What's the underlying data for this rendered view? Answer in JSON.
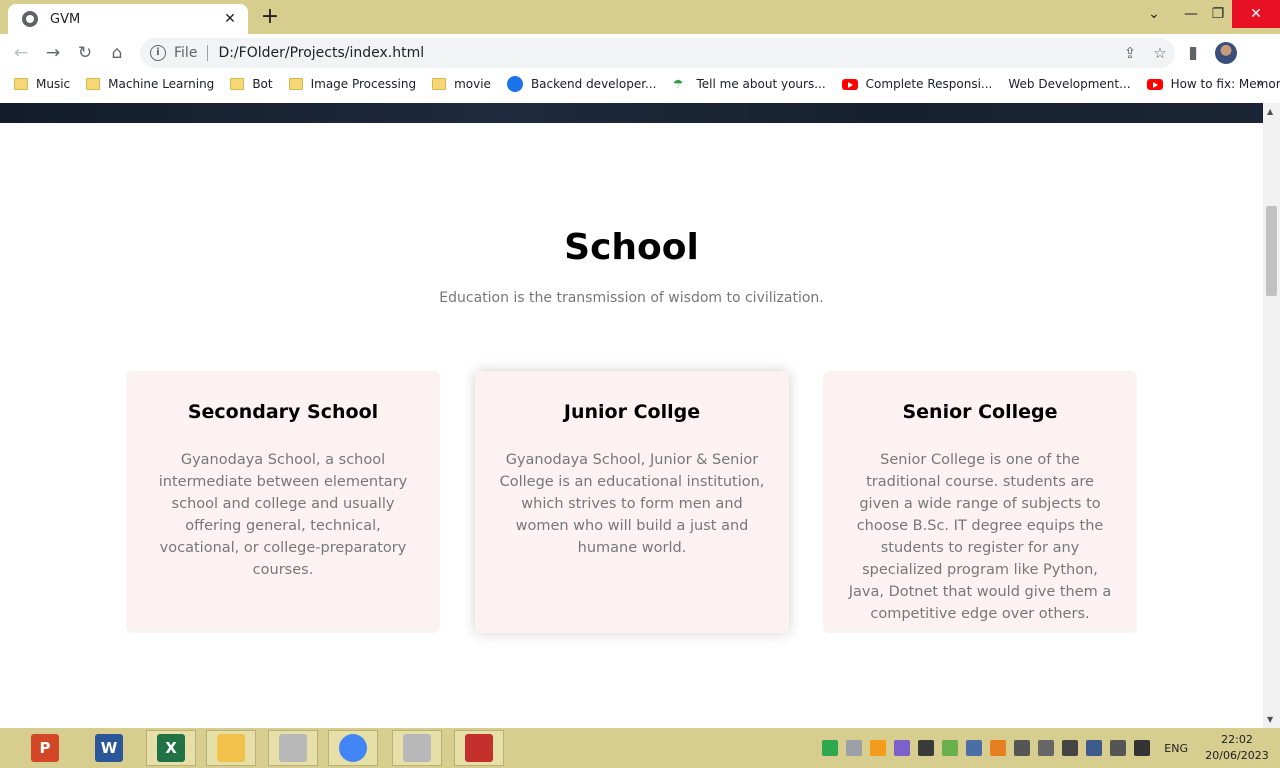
{
  "browser": {
    "tab_title": "GVM",
    "tab_close": "✕",
    "new_tab": "+",
    "omnibox": {
      "info_icon": "i",
      "scheme": "File",
      "url": "D:/FOlder/Projects/index.html"
    },
    "bookmarks": [
      {
        "label": "Music",
        "icon": "folder-icon"
      },
      {
        "label": "Machine Learning",
        "icon": "folder-icon"
      },
      {
        "label": "Bot",
        "icon": "folder-icon"
      },
      {
        "label": "Image Processing",
        "icon": "folder-icon"
      },
      {
        "label": "movie",
        "icon": "folder-icon"
      },
      {
        "label": "Backend developer...",
        "icon": "round-logo-icon"
      },
      {
        "label": "Tell me about yours...",
        "icon": "umbrella-icon"
      },
      {
        "label": "Complete Responsi...",
        "icon": "youtube-icon"
      },
      {
        "label": "Web Development...",
        "icon": "none"
      },
      {
        "label": "How to fix: Memory...",
        "icon": "youtube-icon"
      }
    ],
    "more_bookmarks": "»"
  },
  "page": {
    "section_title": "School",
    "section_subtitle": "Education is the transmission of wisdom to civilization.",
    "cards": [
      {
        "title": "Secondary School",
        "text": "Gyanodaya School, a school intermediate between elementary school and college and usually offering general, technical, vocational, or college-preparatory courses."
      },
      {
        "title": "Junior Collge",
        "text": "Gyanodaya School, Junior & Senior College is an educational institution, which strives to form men and women who will build a just and humane world."
      },
      {
        "title": "Senior College",
        "text": "Senior College is one of the traditional course. students are given a wide range of subjects to choose B.Sc. IT degree equips the students to register for any specialized program like Python, Java, Dotnet that would give them a competitive edge over others."
      }
    ]
  },
  "taskbar": {
    "apps": [
      {
        "name": "powerpoint",
        "glyph": "P",
        "color": "#d24726"
      },
      {
        "name": "word",
        "glyph": "W",
        "color": "#2b579a"
      },
      {
        "name": "excel",
        "glyph": "X",
        "color": "#217346"
      },
      {
        "name": "file-explorer",
        "glyph": "",
        "color": "#f0c24a"
      },
      {
        "name": "app-spider",
        "glyph": "",
        "color": "#b8b8b8"
      },
      {
        "name": "chrome",
        "glyph": "",
        "color": "#4285f4"
      },
      {
        "name": "app-spider-2",
        "glyph": "",
        "color": "#b8b8b8"
      },
      {
        "name": "acrobat",
        "glyph": "",
        "color": "#c4302b"
      }
    ],
    "language": "ENG",
    "time": "22:02",
    "date": "20/06/2023"
  }
}
